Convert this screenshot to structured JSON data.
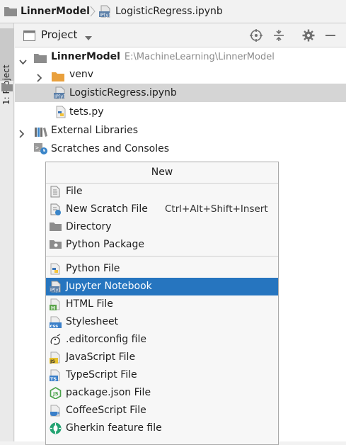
{
  "breadcrumb": {
    "project": "LinnerModel",
    "file": "LogisticRegress.ipynb"
  },
  "sidebar": {
    "tab_label": "1: Project"
  },
  "project_panel": {
    "view_label": "Project"
  },
  "tree": {
    "root_name": "LinnerModel",
    "root_path": "E:\\MachineLearning\\LinnerModel",
    "venv": "venv",
    "notebook": "LogisticRegress.ipynb",
    "pyfile": "tets.py",
    "ext_libs": "External Libraries",
    "scratches": "Scratches and Consoles"
  },
  "menu": {
    "title": "New",
    "items": [
      {
        "label": "File",
        "shortcut": "",
        "icon": "file-icon"
      },
      {
        "label": "New Scratch File",
        "shortcut": "Ctrl+Alt+Shift+Insert",
        "icon": "scratch-file-icon"
      },
      {
        "label": "Directory",
        "shortcut": "",
        "icon": "folder-icon"
      },
      {
        "label": "Python Package",
        "shortcut": "",
        "icon": "package-folder-icon"
      },
      {
        "label": "Python File",
        "shortcut": "",
        "icon": "python-icon"
      },
      {
        "label": "Jupyter Notebook",
        "shortcut": "",
        "icon": "jupyter-icon"
      },
      {
        "label": "HTML File",
        "shortcut": "",
        "icon": "html-icon"
      },
      {
        "label": "Stylesheet",
        "shortcut": "",
        "icon": "css-icon"
      },
      {
        "label": ".editorconfig file",
        "shortcut": "",
        "icon": "editorconfig-icon"
      },
      {
        "label": "JavaScript File",
        "shortcut": "",
        "icon": "javascript-icon"
      },
      {
        "label": "TypeScript File",
        "shortcut": "",
        "icon": "typescript-icon"
      },
      {
        "label": "package.json File",
        "shortcut": "",
        "icon": "nodejs-icon"
      },
      {
        "label": "CoffeeScript File",
        "shortcut": "",
        "icon": "coffeescript-icon"
      },
      {
        "label": "Gherkin feature file",
        "shortcut": "",
        "icon": "gherkin-icon"
      }
    ],
    "highlighted": "Jupyter Notebook"
  },
  "colors": {
    "highlight": "#2675bf",
    "selection": "#d5d5d5",
    "folder": "#8c8c8c",
    "venv_folder": "#e9a03d"
  }
}
